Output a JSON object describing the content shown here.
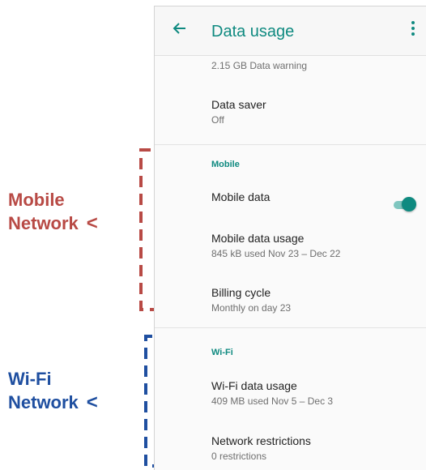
{
  "appbar": {
    "title": "Data usage"
  },
  "rows": {
    "warning": "2.15 GB Data warning",
    "data_saver": {
      "title": "Data saver",
      "sub": "Off"
    },
    "mobile_header": "Mobile",
    "mobile_data": {
      "title": "Mobile data",
      "toggle_on": true
    },
    "mobile_usage": {
      "title": "Mobile data usage",
      "sub": "845 kB used Nov 23 – Dec 22"
    },
    "billing": {
      "title": "Billing cycle",
      "sub": "Monthly on day 23"
    },
    "wifi_header": "Wi-Fi",
    "wifi_usage": {
      "title": "Wi-Fi data usage",
      "sub": "409 MB used Nov 5 – Dec 3"
    },
    "restrictions": {
      "title": "Network restrictions",
      "sub": "0 restrictions"
    }
  },
  "annotations": {
    "mobile": {
      "line1": "Mobile",
      "line2": "Network",
      "arrow": "<"
    },
    "wifi": {
      "line1": "Wi-Fi",
      "line2": "Network",
      "arrow": "<"
    }
  },
  "colors": {
    "accent": "#0f8a80",
    "mobile_annotation": "#b84a45",
    "wifi_annotation": "#1f4fa0"
  }
}
